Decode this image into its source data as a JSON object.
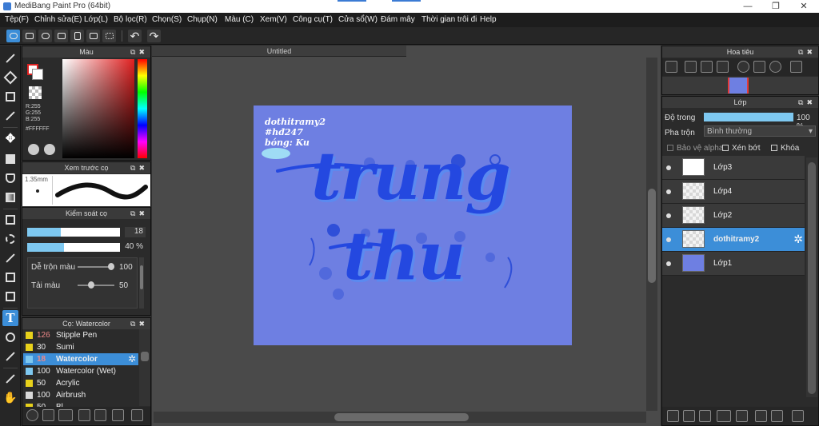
{
  "window": {
    "title": "MediBang Paint Pro (64bit)",
    "min": "—",
    "max": "❐",
    "close": "✕"
  },
  "menu": [
    "Tệp(F)",
    "Chỉnh sửa(E)",
    "Lớp(L)",
    "Bộ lọc(R)",
    "Chọn(S)",
    "Chụp(N)",
    "Màu (C)",
    "Xem(V)",
    "Công cụ(T)",
    "Cửa sổ(W)",
    "Đám mây",
    "Thời gian trôi đi",
    "Help"
  ],
  "toolbar": {
    "undo": "↶",
    "redo": "↷"
  },
  "color_panel": {
    "title": "Màu",
    "r": "R:255",
    "g": "G:255",
    "b": "B:255",
    "hex": "#FFFFFF"
  },
  "preview_panel": {
    "title": "Xem trước cọ",
    "size": "1.35mm"
  },
  "brush_control": {
    "title": "Kiểm soát cọ",
    "size_value": "18",
    "opacity_value": "40 %",
    "mix_label": "Dễ trộn màu",
    "mix_value": "100",
    "amount_label": "Tải màu",
    "amount_value": "50"
  },
  "brush_list": {
    "title": "Cọ: Watercolor",
    "items": [
      {
        "size": "126",
        "name": "Stipple Pen",
        "color": "#e8d11b"
      },
      {
        "size": "30",
        "name": "Sumi",
        "color": "#e8d11b"
      },
      {
        "size": "18",
        "name": "Watercolor",
        "color": "#7ec8f0",
        "selected": true
      },
      {
        "size": "100",
        "name": "Watercolor (Wet)",
        "color": "#7ec8f0"
      },
      {
        "size": "50",
        "name": "Acrylic",
        "color": "#e8d11b"
      },
      {
        "size": "100",
        "name": "Airbrush",
        "color": "#d8d8d8"
      },
      {
        "size": "50",
        "name": "Bl",
        "color": "#e8d11b"
      }
    ]
  },
  "document": {
    "tab": "Untitled"
  },
  "artwork": {
    "note1": "dothitramy2",
    "note2": "#hđ247",
    "note3": "bóng: Ku",
    "word1": "trung",
    "word2": "thu",
    "bg": "#6e7fe2",
    "ink": "#2448e0"
  },
  "navigator": {
    "title": "Hoa tiêu"
  },
  "layer_panel": {
    "title": "Lớp",
    "opacity_label": "Độ trong",
    "opacity_value": "100 %",
    "blend_label": "Pha trộn",
    "blend_value": "Bình thường",
    "protect_alpha": "Bảo vệ alpha",
    "clipping": "Xén bớt",
    "lock": "Khóa",
    "layers": [
      {
        "name": "Lớp3",
        "kind": "art"
      },
      {
        "name": "Lớp4",
        "kind": "empty"
      },
      {
        "name": "Lớp2",
        "kind": "empty"
      },
      {
        "name": "dothitramy2",
        "kind": "empty",
        "selected": true
      },
      {
        "name": "Lớp1",
        "kind": "fill"
      }
    ]
  },
  "colors": {
    "accent": "#3c8ed8",
    "canvas_bg": "#4a4a4a",
    "panel_bg": "#2b2b2b"
  }
}
